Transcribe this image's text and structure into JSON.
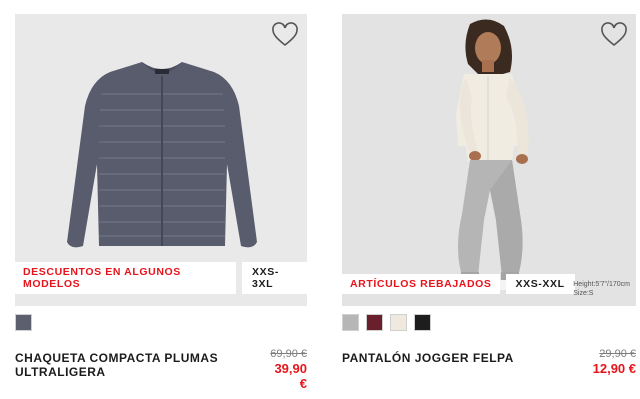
{
  "products": [
    {
      "name": "CHAQUETA COMPACTA PLUMAS ULTRALIGERA",
      "promo_badge": "DESCUENTOS EN ALGUNOS MODELOS",
      "size_badge": "XXS-3XL",
      "old_price": "69,90 €",
      "new_price": "39,90 €",
      "swatches": [
        "#5c5f6e"
      ],
      "image": "navy-quilted-jacket-photo",
      "wishlist_icon": "heart-outline-icon"
    },
    {
      "name": "PANTALÓN JOGGER FELPA",
      "promo_badge": "ARTÍCULOS REBAJADOS",
      "size_badge": "XXS-XXL",
      "fit_line1": "Height:5'7\"/170cm",
      "fit_line2": "Size:S",
      "old_price": "29,90 €",
      "new_price": "12,90 €",
      "swatches": [
        "#b6b6b6",
        "#6a1f2c",
        "#efe9df",
        "#1d1d1d"
      ],
      "image": "model-grey-jogger-photo",
      "wishlist_icon": "heart-outline-icon"
    }
  ]
}
